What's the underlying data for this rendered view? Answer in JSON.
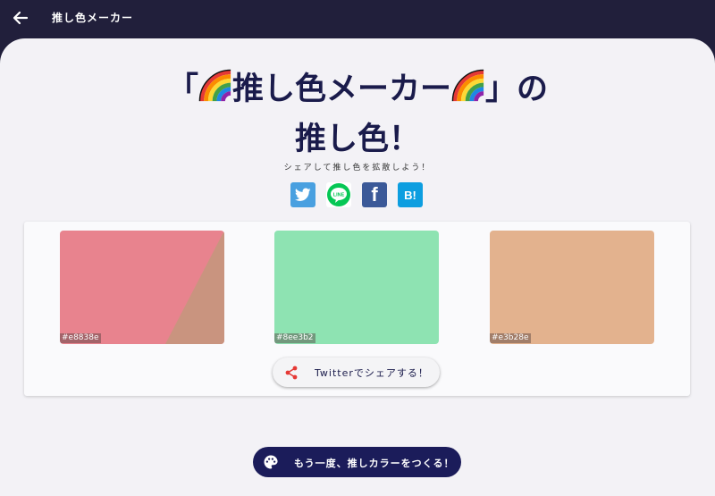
{
  "header": {
    "back_icon": "arrow-left-icon",
    "title": "推し色メーカー"
  },
  "headline": {
    "open_bracket": "「",
    "name": "推し色メーカー",
    "close_suffix": "」の",
    "line2": "推し色！",
    "emoji": "rainbow-icon"
  },
  "subtitle": "シェアして推し色を拡散しよう！",
  "share_services": [
    {
      "name": "twitter",
      "icon": "twitter-icon",
      "color": "#49a0e0"
    },
    {
      "name": "line",
      "icon": "line-icon",
      "label": "LINE",
      "color": "#06c755"
    },
    {
      "name": "facebook",
      "icon": "facebook-icon",
      "label": "f",
      "color": "#3b5998"
    },
    {
      "name": "hatena",
      "icon": "hatena-bookmark-icon",
      "label": "B!",
      "color": "#0d9ee0"
    }
  ],
  "colors": [
    {
      "hex": "#e8838e",
      "label": "#e8838e"
    },
    {
      "hex": "#8ee3b2",
      "label": "#8ee3b2"
    },
    {
      "hex": "#e3b28e",
      "label": "#e3b28e"
    }
  ],
  "share_button": {
    "label": "Twitterでシェアする！",
    "icon": "share-icon",
    "icon_color": "#e53935"
  },
  "cta_button": {
    "label": "もう一度、推しカラーをつくる！",
    "icon": "palette-icon"
  }
}
